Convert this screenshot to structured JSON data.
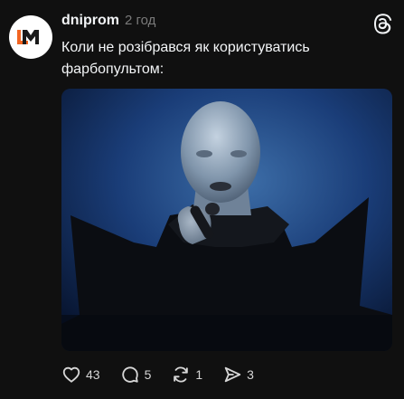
{
  "post": {
    "username": "dniprom",
    "timestamp": "2 год",
    "text": "Коли не розібрався як користуватись фарбопультом:",
    "avatar_icon": "dm-logo-icon",
    "platform_icon": "threads-icon",
    "brand_colors": {
      "logo_orange": "#f26522",
      "logo_dark": "#1a1a1a"
    }
  },
  "actions": {
    "likes": "43",
    "replies": "5",
    "reposts": "1",
    "shares": "3",
    "icons": [
      "heart-icon",
      "comment-icon",
      "repost-icon",
      "share-icon"
    ]
  },
  "colors": {
    "background": "#101010",
    "text": "#f3f5f7",
    "secondary_text": "#7a7a7a"
  }
}
